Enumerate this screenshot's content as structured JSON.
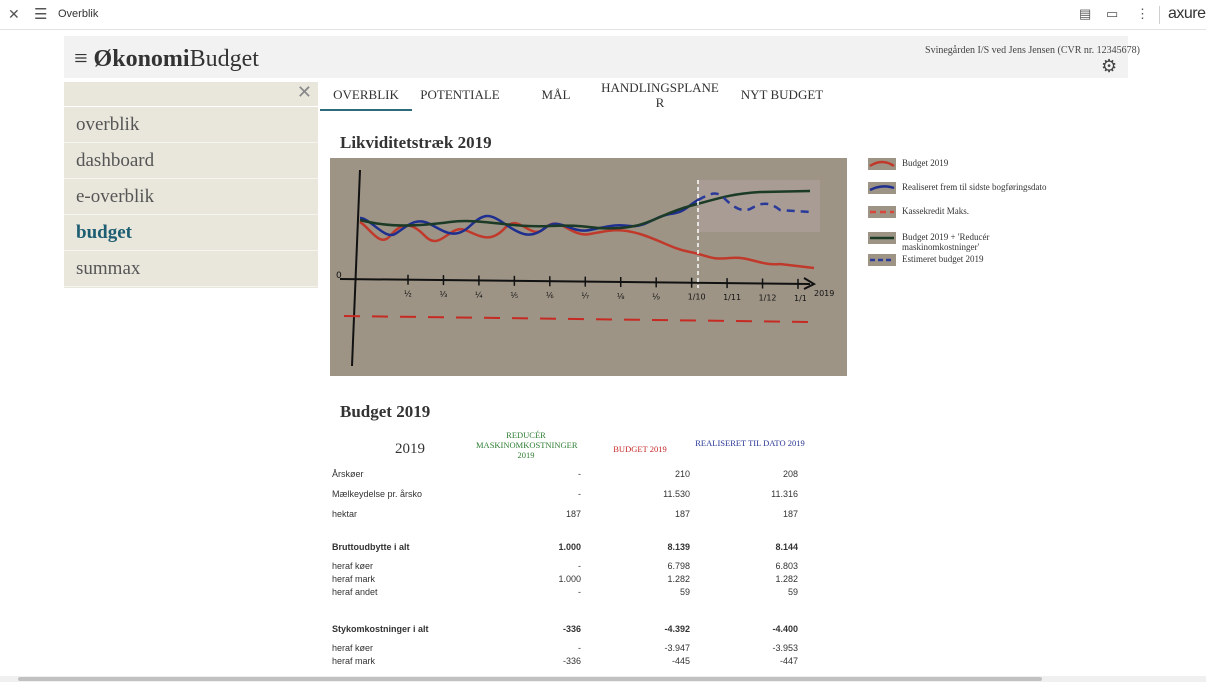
{
  "toolbar": {
    "page_name": "Overblik",
    "brand": "axure"
  },
  "header": {
    "logo_bold": "Økonomi",
    "logo_regular": "Budget",
    "company": "Svinegården I/S ved Jens Jensen (CVR nr. 12345678)"
  },
  "sidebar": {
    "items": [
      {
        "label": "overblik"
      },
      {
        "label": "dashboard"
      },
      {
        "label": "e-overblik"
      },
      {
        "label": "budget"
      },
      {
        "label": "summax"
      }
    ]
  },
  "tabs": [
    {
      "label": "OVERBLIK"
    },
    {
      "label": "POTENTIALE"
    },
    {
      "label": "MÅL"
    },
    {
      "label": "HANDLINGSPLANE R"
    },
    {
      "label": "NYT BUDGET"
    }
  ],
  "chart": {
    "title": "Likviditetstræk 2019",
    "zero_label": "0",
    "x_ticks": [
      "½",
      "⅓",
      "¼",
      "⅕",
      "⅙",
      "⅐",
      "⅛",
      "⅑",
      "1/10",
      "1/11",
      "1/12",
      "1/1"
    ],
    "x_end_label": "2019",
    "legend": [
      {
        "label": "Budget 2019",
        "color": "#c0392b"
      },
      {
        "label": "Realiseret frem til sidste bogføringsdato",
        "color": "#1f2f8f"
      },
      {
        "label": "Kassekredit Maks.",
        "color": "#d9463a"
      },
      {
        "label": "Budget 2019 + 'Reducér maskinomkostninger'",
        "color": "#1b3b26"
      },
      {
        "label": "Estimeret budget 2019",
        "color": "#2a3a9a"
      }
    ]
  },
  "table": {
    "title": "Budget 2019",
    "year": "2019",
    "col1": "REDUCÉR MASKINOMKOSTNINGER 2019",
    "col2": "BUDGET 2019",
    "col3": "REALISERET TIL DATO 2019",
    "rows": [
      {
        "label": "Årskøer",
        "c1": "-",
        "c2": "210",
        "c3": "208"
      },
      {
        "label": "Mælkeydelse pr. årsko",
        "c1": "-",
        "c2": "11.530",
        "c3": "11.316"
      },
      {
        "label": "hektar",
        "c1": "187",
        "c2": "187",
        "c3": "187"
      },
      {
        "label": "Bruttoudbytte i alt",
        "c1": "1.000",
        "c2": "8.139",
        "c3": "8.144"
      },
      {
        "label": "heraf køer",
        "c1": "-",
        "c2": "6.798",
        "c3": "6.803"
      },
      {
        "label": "heraf mark",
        "c1": "1.000",
        "c2": "1.282",
        "c3": "1.282"
      },
      {
        "label": "heraf andet",
        "c1": "-",
        "c2": "59",
        "c3": "59"
      },
      {
        "label": "Stykomkostninger i alt",
        "c1": "-336",
        "c2": "-4.392",
        "c3": "-4.400"
      },
      {
        "label": "heraf køer",
        "c1": "-",
        "c2": "-3.947",
        "c3": "-3.953"
      },
      {
        "label": "heraf mark",
        "c1": "-336",
        "c2": "-445",
        "c3": "-447"
      }
    ]
  },
  "colors": {
    "accent": "#1e5e72",
    "green_header": "#2e7d32",
    "red_header": "#c62828",
    "blue_header": "#283593"
  }
}
